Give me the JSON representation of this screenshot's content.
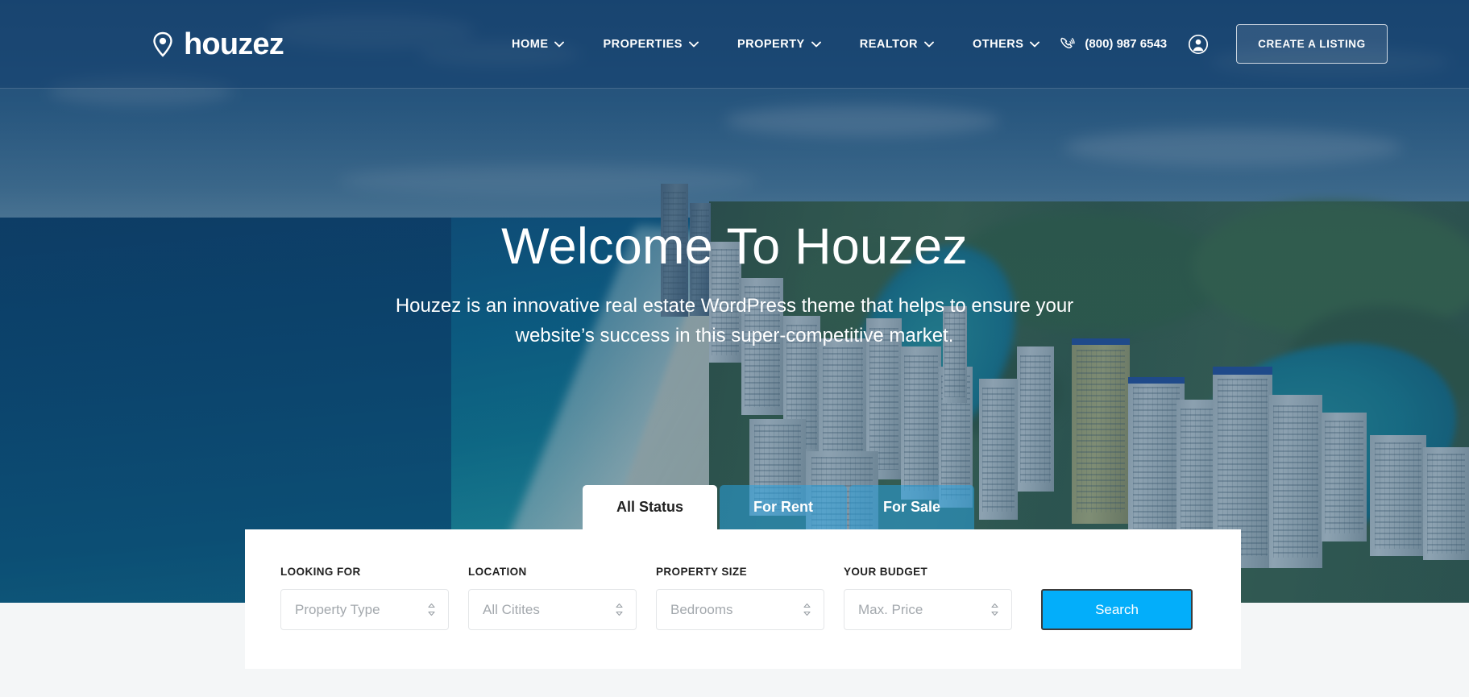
{
  "brand": {
    "name": "houzez",
    "logo_icon": "map-pin-icon"
  },
  "header": {
    "nav": [
      {
        "label": "HOME",
        "icon": "chevron-down-icon"
      },
      {
        "label": "PROPERTIES",
        "icon": "chevron-down-icon"
      },
      {
        "label": "PROPERTY",
        "icon": "chevron-down-icon"
      },
      {
        "label": "REALTOR",
        "icon": "chevron-down-icon"
      },
      {
        "label": "OTHERS",
        "icon": "chevron-down-icon"
      }
    ],
    "phone": {
      "number": "(800) 987 6543",
      "icon": "phone-ring-icon"
    },
    "account_icon": "user-circle-icon",
    "cta_label": "CREATE A LISTING"
  },
  "hero": {
    "title": "Welcome To Houzez",
    "subtitle": "Houzez is an innovative real estate WordPress theme that helps to ensure your website’s success in this super-competitive market."
  },
  "search": {
    "tabs": [
      {
        "label": "All Status",
        "active": true
      },
      {
        "label": "For Rent",
        "active": false
      },
      {
        "label": "For Sale",
        "active": false
      }
    ],
    "fields": [
      {
        "label": "LOOKING FOR",
        "placeholder": "Property Type",
        "icon": "up-down-chevron-icon"
      },
      {
        "label": "LOCATION",
        "placeholder": "All Citites",
        "icon": "up-down-chevron-icon"
      },
      {
        "label": "PROPERTY SIZE",
        "placeholder": "Bedrooms",
        "icon": "up-down-chevron-icon"
      },
      {
        "label": "YOUR BUDGET",
        "placeholder": "Max. Price",
        "icon": "up-down-chevron-icon"
      }
    ],
    "submit_label": "Search"
  },
  "colors": {
    "accent_blue": "#03aefa",
    "header_tint": "#14406e",
    "page_bg": "#f4f6f7",
    "tab_inactive": "#2aa3de"
  }
}
